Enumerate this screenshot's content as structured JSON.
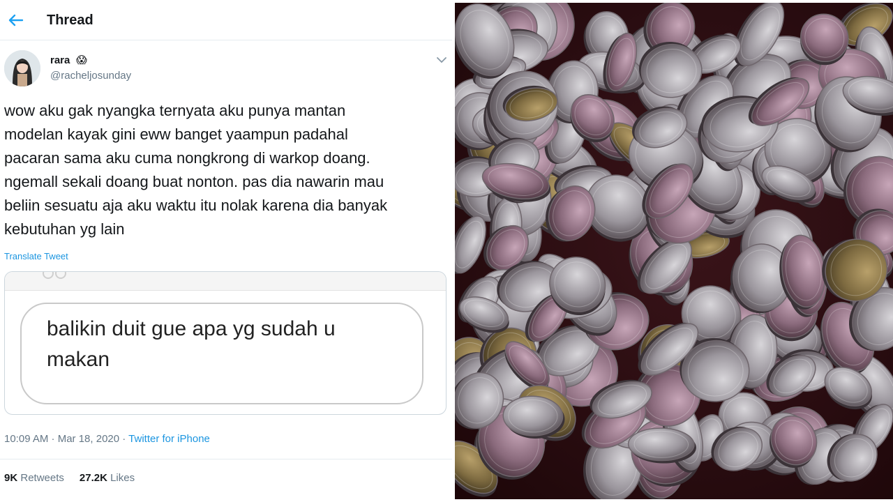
{
  "header": {
    "title": "Thread",
    "back_icon": "arrow-left-icon"
  },
  "tweet": {
    "display_name": "rara",
    "name_emoji": "😱",
    "username": "@racheljosunday",
    "text": "wow aku gak nyangka ternyata aku punya mantan\nmodelan kayak gini eww banget yaampun padahal\npacaran sama aku cuma nongkrong di warkop doang.\nngemall sekali doang buat nonton. pas dia nawarin mau\nbeliin sesuatu aja aku waktu itu nolak karena dia banyak\nkebutuhan yg lain",
    "translate_label": "Translate Tweet",
    "media_text": "balikin duit gue apa yg sudah u\nmakan",
    "time": "10:09 AM · Mar 18, 2020 · ",
    "source": "Twitter for iPhone",
    "retweets": "9K",
    "retweets_label": "Retweets",
    "likes": "27.2K",
    "likes_label": "Likes"
  },
  "colors": {
    "link": "#1b95e0",
    "secondary_text": "#657786",
    "photo_background": "#2a0d11"
  },
  "photo": {
    "subject": "pile-of-coins-image"
  }
}
